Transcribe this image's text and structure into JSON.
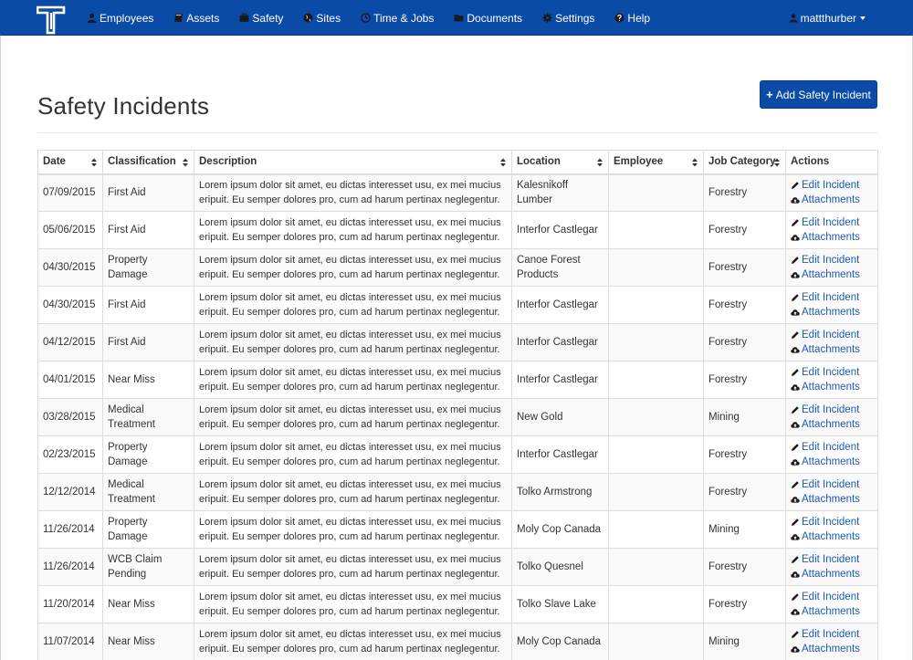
{
  "nav": {
    "brand_icon": "t-logo-icon",
    "items": [
      {
        "label": "Employees",
        "icon": "user-icon"
      },
      {
        "label": "Assets",
        "icon": "book-icon"
      },
      {
        "label": "Safety",
        "icon": "briefcase-icon"
      },
      {
        "label": "Sites",
        "icon": "globe-icon"
      },
      {
        "label": "Time & Jobs",
        "icon": "clock-icon"
      },
      {
        "label": "Documents",
        "icon": "folder-icon"
      },
      {
        "label": "Settings",
        "icon": "gear-icon"
      },
      {
        "label": "Help",
        "icon": "question-icon"
      }
    ],
    "user": "mattthurber"
  },
  "page": {
    "title": "Safety Incidents",
    "add_button": "Add Safety Incident"
  },
  "table": {
    "columns": [
      "Date",
      "Classification",
      "Description",
      "Location",
      "Employee",
      "Job Category",
      "Actions"
    ],
    "action_labels": {
      "edit": "Edit Incident",
      "attachments": "Attachments"
    },
    "rows": [
      {
        "date": "07/09/2015",
        "classification": "First Aid",
        "description": "Lorem ipsum dolor sit amet, eu dictas interesset usu, ex mei mucius eripuit. Eu semper dolores pro, cum ad harum pertinax neglegentur.",
        "location": "Kalesnikoff Lumber",
        "employee": "",
        "job_category": "Forestry"
      },
      {
        "date": "05/06/2015",
        "classification": "First Aid",
        "description": "Lorem ipsum dolor sit amet, eu dictas interesset usu, ex mei mucius eripuit. Eu semper dolores pro, cum ad harum pertinax neglegentur.",
        "location": "Interfor Castlegar",
        "employee": "",
        "job_category": "Forestry"
      },
      {
        "date": "04/30/2015",
        "classification": "Property Damage",
        "description": "Lorem ipsum dolor sit amet, eu dictas interesset usu, ex mei mucius eripuit. Eu semper dolores pro, cum ad harum pertinax neglegentur.",
        "location": "Canoe Forest Products",
        "employee": "",
        "job_category": "Forestry"
      },
      {
        "date": "04/30/2015",
        "classification": "First Aid",
        "description": "Lorem ipsum dolor sit amet, eu dictas interesset usu, ex mei mucius eripuit. Eu semper dolores pro, cum ad harum pertinax neglegentur.",
        "location": "Interfor Castlegar",
        "employee": "",
        "job_category": "Forestry"
      },
      {
        "date": "04/12/2015",
        "classification": "First Aid",
        "description": "Lorem ipsum dolor sit amet, eu dictas interesset usu, ex mei mucius eripuit. Eu semper dolores pro, cum ad harum pertinax neglegentur.",
        "location": "Interfor Castlegar",
        "employee": "",
        "job_category": "Forestry"
      },
      {
        "date": "04/01/2015",
        "classification": "Near Miss",
        "description": "Lorem ipsum dolor sit amet, eu dictas interesset usu, ex mei mucius eripuit. Eu semper dolores pro, cum ad harum pertinax neglegentur.",
        "location": "Interfor Castlegar",
        "employee": "",
        "job_category": "Forestry"
      },
      {
        "date": "03/28/2015",
        "classification": "Medical Treatment",
        "description": "Lorem ipsum dolor sit amet, eu dictas interesset usu, ex mei mucius eripuit. Eu semper dolores pro, cum ad harum pertinax neglegentur.",
        "location": "New Gold",
        "employee": "",
        "job_category": "Mining"
      },
      {
        "date": "02/23/2015",
        "classification": "Property Damage",
        "description": "Lorem ipsum dolor sit amet, eu dictas interesset usu, ex mei mucius eripuit. Eu semper dolores pro, cum ad harum pertinax neglegentur.",
        "location": "Interfor Castlegar",
        "employee": "",
        "job_category": "Forestry"
      },
      {
        "date": "12/12/2014",
        "classification": "Medical Treatment",
        "description": "Lorem ipsum dolor sit amet, eu dictas interesset usu, ex mei mucius eripuit. Eu semper dolores pro, cum ad harum pertinax neglegentur.",
        "location": "Tolko Armstrong",
        "employee": "",
        "job_category": "Forestry"
      },
      {
        "date": "11/26/2014",
        "classification": "Property Damage",
        "description": "Lorem ipsum dolor sit amet, eu dictas interesset usu, ex mei mucius eripuit. Eu semper dolores pro, cum ad harum pertinax neglegentur.",
        "location": "Moly Cop Canada",
        "employee": "",
        "job_category": "Mining"
      },
      {
        "date": "11/26/2014",
        "classification": "WCB Claim Pending",
        "description": "Lorem ipsum dolor sit amet, eu dictas interesset usu, ex mei mucius eripuit. Eu semper dolores pro, cum ad harum pertinax neglegentur.",
        "location": "Tolko Quesnel",
        "employee": "",
        "job_category": "Forestry"
      },
      {
        "date": "11/20/2014",
        "classification": "Near Miss",
        "description": "Lorem ipsum dolor sit amet, eu dictas interesset usu, ex mei mucius eripuit. Eu semper dolores pro, cum ad harum pertinax neglegentur.",
        "location": "Tolko Slave Lake",
        "employee": "",
        "job_category": "Forestry"
      },
      {
        "date": "11/07/2014",
        "classification": "Near Miss",
        "description": "Lorem ipsum dolor sit amet, eu dictas interesset usu, ex mei mucius eripuit. Eu semper dolores pro, cum ad harum pertinax neglegentur.",
        "location": "Moly Cop Canada",
        "employee": "",
        "job_category": "Mining"
      }
    ]
  },
  "colors": {
    "navbar": "#0a4ba8",
    "link": "#1d5ab4",
    "button": "#0a4ba8"
  }
}
